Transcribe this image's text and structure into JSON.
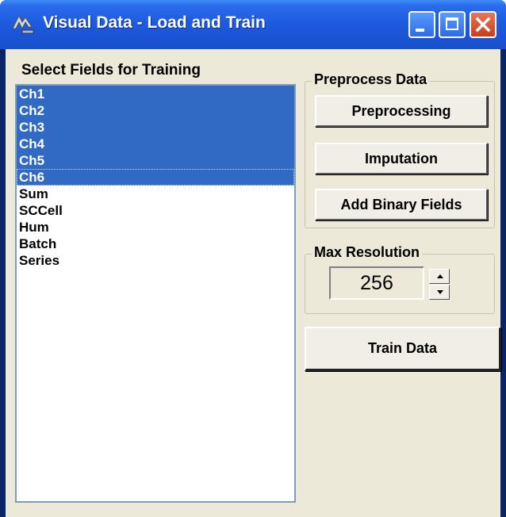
{
  "window": {
    "title": "Visual Data - Load and Train",
    "app_icon": "app-icon",
    "controls": [
      "minimize-icon",
      "maximize-icon",
      "close-icon"
    ]
  },
  "fields": {
    "label": "Select Fields for Training",
    "items": [
      {
        "label": "Ch1",
        "selected": true
      },
      {
        "label": "Ch2",
        "selected": true
      },
      {
        "label": "Ch3",
        "selected": true
      },
      {
        "label": "Ch4",
        "selected": true
      },
      {
        "label": "Ch5",
        "selected": true
      },
      {
        "label": "Ch6",
        "selected": true,
        "focused": true
      },
      {
        "label": "Sum",
        "selected": false
      },
      {
        "label": "SCCell",
        "selected": false
      },
      {
        "label": "Hum",
        "selected": false
      },
      {
        "label": "Batch",
        "selected": false
      },
      {
        "label": "Series",
        "selected": false
      }
    ]
  },
  "preprocess": {
    "legend": "Preprocess Data",
    "preprocessing_label": "Preprocessing",
    "imputation_label": "Imputation",
    "add_binary_label": "Add Binary Fields"
  },
  "resolution": {
    "legend": "Max Resolution",
    "value": "256"
  },
  "train_label": "Train Data",
  "colors": {
    "titlebar": "#1E5BE0",
    "selection": "#316AC5",
    "dialog_bg": "#ECE9D8"
  }
}
